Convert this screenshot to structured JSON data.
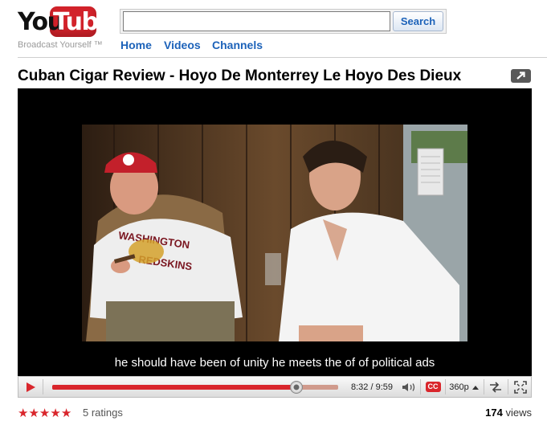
{
  "header": {
    "logo_you": "You",
    "logo_tube": "Tube",
    "tagline": "Broadcast Yourself ™",
    "search_value": "",
    "search_button": "Search",
    "nav": [
      "Home",
      "Videos",
      "Channels"
    ]
  },
  "video": {
    "title": "Cuban Cigar Review - Hoyo De Monterrey Le Hoyo Des Dieux",
    "subtitle": "he should have been of unity he meets the of of political ads",
    "shirt_text_1": "WASHINGTON",
    "shirt_text_2": "REDSKINS"
  },
  "player": {
    "time_current": "8:32",
    "time_total": "9:59",
    "time_display": "8:32 / 9:59",
    "progress_fraction": 0.855,
    "cc_label": "CC",
    "quality": "360p"
  },
  "stats": {
    "star_count": 5,
    "ratings": "5 ratings",
    "views_count": "174",
    "views_label": "views"
  },
  "colors": {
    "brand_red": "#d9262c",
    "link_blue": "#1c62b9"
  },
  "icons": {
    "play": "play-icon",
    "volume": "volume-icon",
    "cc": "closed-captions-icon",
    "quality": "quality-arrow-icon",
    "popout": "popout-icon",
    "widescreen": "widescreen-icon",
    "fullscreen": "fullscreen-icon"
  }
}
